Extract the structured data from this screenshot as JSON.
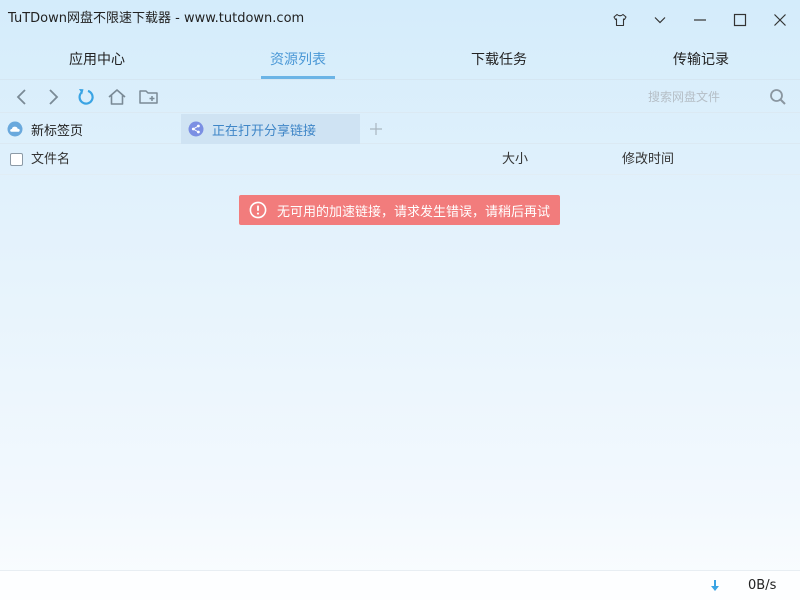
{
  "window": {
    "title": "TuTDown网盘不限速下载器 - www.tutdown.com",
    "controls": [
      "skin-icon",
      "dropdown-icon",
      "minimize-icon",
      "maximize-icon",
      "close-icon"
    ]
  },
  "main_tabs": [
    {
      "label": "应用中心",
      "active": false
    },
    {
      "label": "资源列表",
      "active": true
    },
    {
      "label": "下载任务",
      "active": false
    },
    {
      "label": "传输记录",
      "active": false
    }
  ],
  "toolbar": {
    "icons": [
      "back-icon",
      "forward-icon",
      "refresh-icon",
      "home-icon",
      "new-folder-icon"
    ],
    "search_placeholder": "搜索网盘文件",
    "search_value": ""
  },
  "page_tabs": [
    {
      "label": "新标签页",
      "icon": "cloud-icon",
      "active": false
    },
    {
      "label": "正在打开分享链接",
      "icon": "share-icon",
      "active": true
    }
  ],
  "columns": {
    "name": "文件名",
    "size": "大小",
    "modified": "修改时间"
  },
  "toast": {
    "message": "无可用的加速链接，请求发生错误，请稍后再试",
    "icon": "error-icon"
  },
  "status": {
    "speed": "0B/s",
    "icon": "download-arrow-icon"
  },
  "colors": {
    "accent": "#4a98d6",
    "tab_underline": "#6bb4e6",
    "error": "#f27c7c",
    "icon_blue": "#3aa4e4",
    "icon_grey": "#7a8a96",
    "share_purple": "#7b8fe3"
  }
}
